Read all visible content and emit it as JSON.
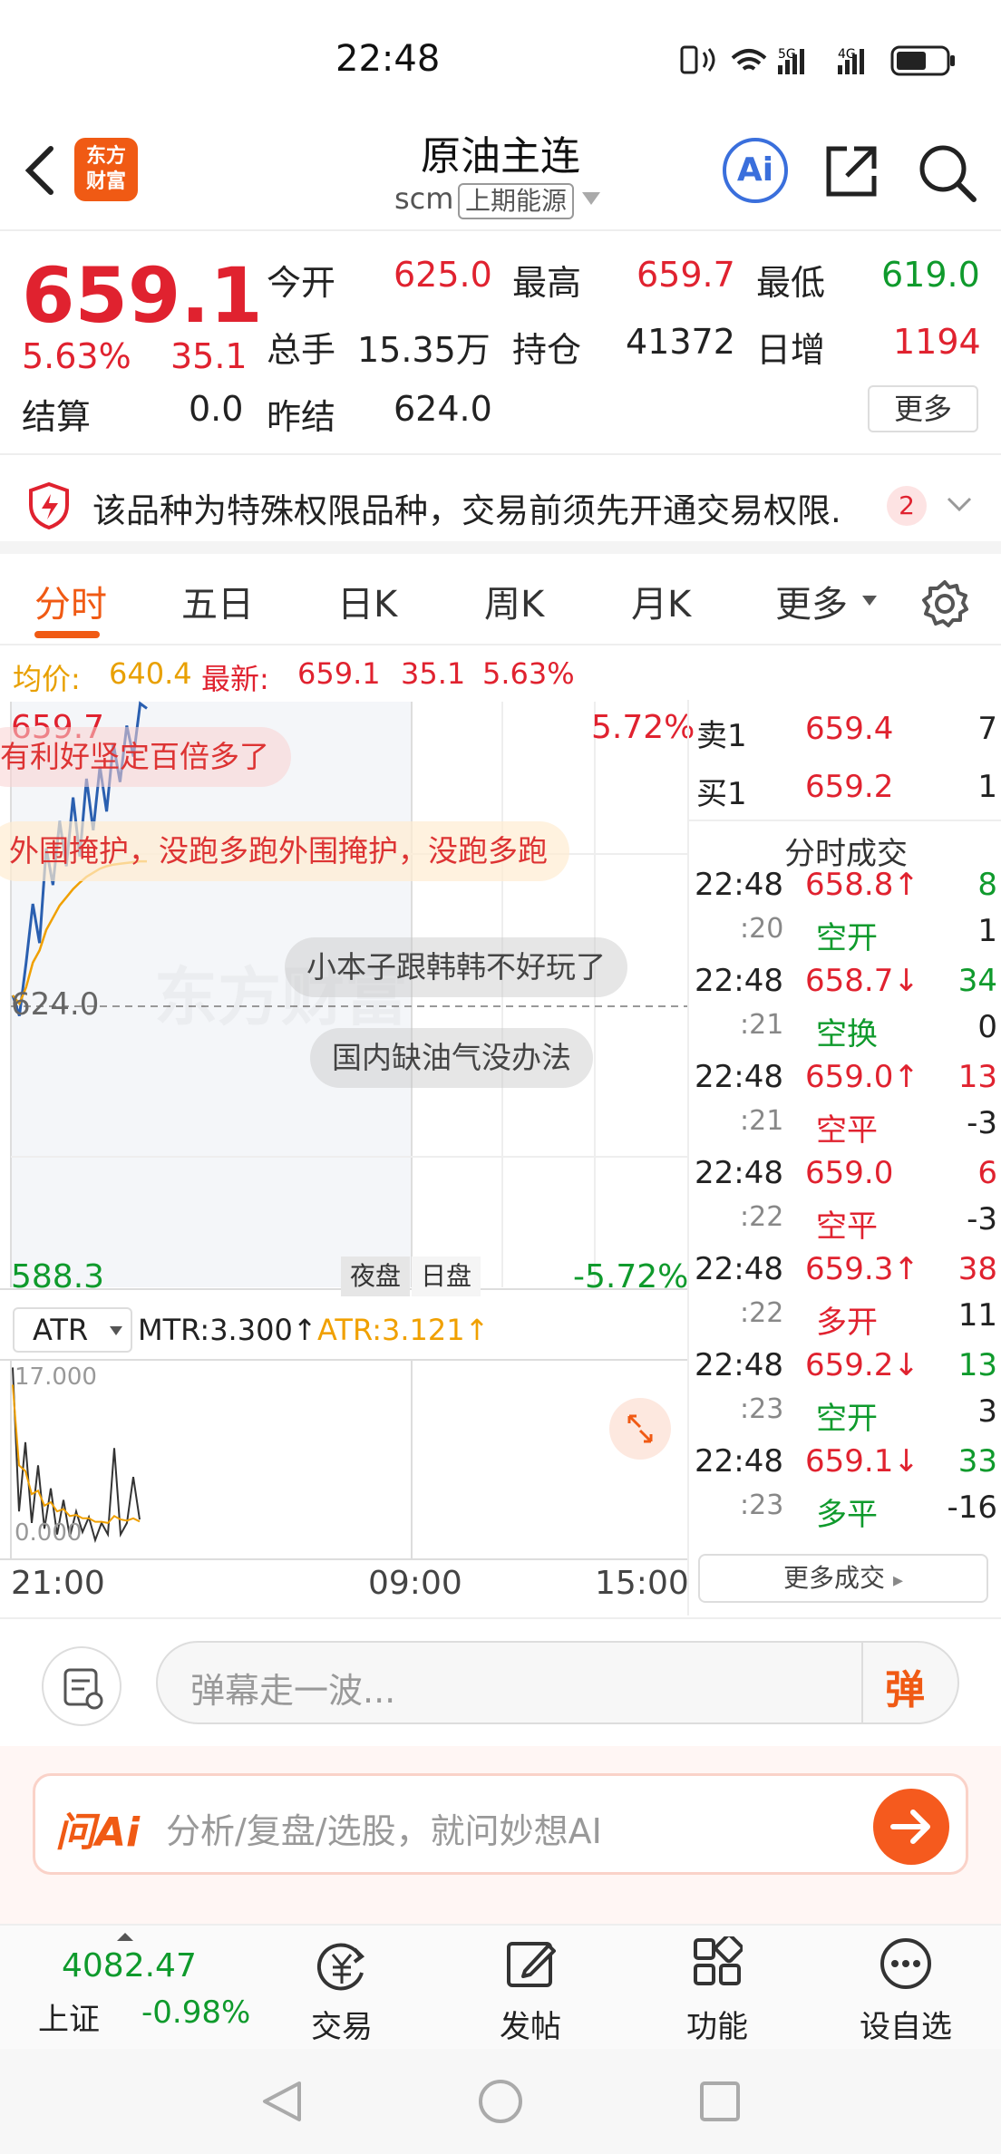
{
  "status": {
    "time": "22:48",
    "signal_labels": [
      "5G",
      "4G"
    ]
  },
  "header": {
    "logo_text": "东方财富",
    "title": "原油主连",
    "code": "scm",
    "exchange": "上期能源",
    "ai_label": "Ai"
  },
  "quote": {
    "price": "659.1",
    "change_pct": "5.63%",
    "change": "35.1",
    "open_label": "今开",
    "open": "625.0",
    "high_label": "最高",
    "high": "659.7",
    "low_label": "最低",
    "low": "619.0",
    "volume_label": "总手",
    "volume": "15.35万",
    "oi_label": "持仓",
    "oi": "41372",
    "daily_inc_label": "日增",
    "daily_inc": "1194",
    "settle_label": "结算",
    "settle": "0.0",
    "prev_settle_label": "昨结",
    "prev_settle": "624.0",
    "more": "更多"
  },
  "notice": {
    "text": "该品种为特殊权限品种，交易前须先开通交易权限.",
    "count": "2"
  },
  "tabs": [
    "分时",
    "五日",
    "日K",
    "周K",
    "月K",
    "更多"
  ],
  "avgrow": {
    "avg_label": "均价:",
    "avg": "640.4",
    "latest_label": "最新:",
    "latest": "659.1",
    "chg": "35.1",
    "pct": "5.63%"
  },
  "chart": {
    "top_price": "659.7",
    "top_pct": "5.72%",
    "mid_price": "624.0",
    "bottom_price": "588.3",
    "bottom_pct": "-5.72%",
    "session_night": "夜盘",
    "session_day": "日盘",
    "indicator": "ATR",
    "mtr": "MTR:3.300↑",
    "atr": "ATR:3.121↑",
    "ind_top": "17.000",
    "ind_bottom": "0.000",
    "time_labels": [
      "21:00",
      "09:00",
      "15:00"
    ],
    "watermark": "东方财富",
    "barrages": [
      "有利好坚定百倍多了",
      "外围掩护，没跑多跑外围掩护，没跑多跑",
      "小本子跟韩韩不好玩了",
      "国内缺油气没办法"
    ]
  },
  "chart_data": {
    "type": "line",
    "title": "",
    "ylim": [
      588.3,
      659.7
    ],
    "x_labels": [
      "21:00",
      "09:00",
      "15:00"
    ],
    "series": [
      {
        "name": "",
        "values": [
          624.0,
          621.5,
          628.0,
          635.2,
          630.4,
          642.0,
          637.5,
          645.3,
          639.8,
          648.2,
          641.0,
          650.5,
          644.2,
          652.0,
          646.5,
          654.8,
          650.1,
          657.0,
          653.2,
          659.7,
          659.1
        ]
      },
      {
        "name": "",
        "values": [
          624.0,
          623.0,
          625.0,
          628.0,
          629.5,
          632.0,
          633.5,
          635.0,
          636.0,
          637.0,
          637.8,
          638.5,
          639.0,
          639.5,
          639.8,
          640.0,
          640.1,
          640.2,
          640.3,
          640.4,
          640.4
        ]
      }
    ],
    "indicator_ylim": [
      0.0,
      17.0
    ],
    "indicator_series": [
      {
        "name": "MTR",
        "values": [
          16.5,
          4.0,
          10.0,
          3.0,
          8.0,
          2.5,
          6.0,
          2.0,
          5.0,
          1.8,
          4.0,
          2.2,
          3.5,
          1.5,
          3.0,
          2.0,
          9.5,
          2.0,
          3.0,
          7.0,
          3.3
        ]
      },
      {
        "name": "ATR",
        "values": [
          15.0,
          8.0,
          7.5,
          5.5,
          5.8,
          4.5,
          4.8,
          4.0,
          4.2,
          3.6,
          3.7,
          3.4,
          3.4,
          3.1,
          3.1,
          3.0,
          3.6,
          3.3,
          3.2,
          3.4,
          3.121
        ]
      }
    ]
  },
  "book": {
    "sell1": {
      "label": "卖1",
      "price": "659.4",
      "vol": "7"
    },
    "buy1": {
      "label": "买1",
      "price": "659.2",
      "vol": "1"
    },
    "trades_title": "分时成交",
    "trades": [
      {
        "t": "22:48",
        "p": "658.8↑",
        "v": "8",
        "pc": "red",
        "vc": "green"
      },
      {
        "t": ":20",
        "p": "空开",
        "v": "1",
        "pc": "green",
        "vc": "dark"
      },
      {
        "t": "22:48",
        "p": "658.7↓",
        "v": "34",
        "pc": "red",
        "vc": "green"
      },
      {
        "t": ":21",
        "p": "空换",
        "v": "0",
        "pc": "green",
        "vc": "dark"
      },
      {
        "t": "22:48",
        "p": "659.0↑",
        "v": "13",
        "pc": "red",
        "vc": "red"
      },
      {
        "t": ":21",
        "p": "空平",
        "v": "-3",
        "pc": "red",
        "vc": "dark"
      },
      {
        "t": "22:48",
        "p": "659.0",
        "v": "6",
        "pc": "red",
        "vc": "red"
      },
      {
        "t": ":22",
        "p": "空平",
        "v": "-3",
        "pc": "red",
        "vc": "dark"
      },
      {
        "t": "22:48",
        "p": "659.3↑",
        "v": "38",
        "pc": "red",
        "vc": "red"
      },
      {
        "t": ":22",
        "p": "多开",
        "v": "11",
        "pc": "red",
        "vc": "dark"
      },
      {
        "t": "22:48",
        "p": "659.2↓",
        "v": "13",
        "pc": "red",
        "vc": "green"
      },
      {
        "t": ":23",
        "p": "空开",
        "v": "3",
        "pc": "green",
        "vc": "dark"
      },
      {
        "t": "22:48",
        "p": "659.1↓",
        "v": "33",
        "pc": "red",
        "vc": "green"
      },
      {
        "t": ":23",
        "p": "多平",
        "v": "-16",
        "pc": "green",
        "vc": "dark"
      }
    ],
    "more_trades": "更多成交"
  },
  "barrage_input": {
    "placeholder": "弹幕走一波...",
    "send": "弹"
  },
  "ai_banner": {
    "logo": "问Ai",
    "placeholder": "分析/复盘/选股，就问妙想AI"
  },
  "nav": {
    "index_value": "4082.47",
    "index_name": "上证",
    "index_change": "-0.98%",
    "items": [
      "交易",
      "发帖",
      "功能",
      "设自选"
    ]
  },
  "colors": {
    "up": "#e0222f",
    "down": "#0f9a2c",
    "accent": "#f05a14",
    "avg": "#f0a000"
  }
}
